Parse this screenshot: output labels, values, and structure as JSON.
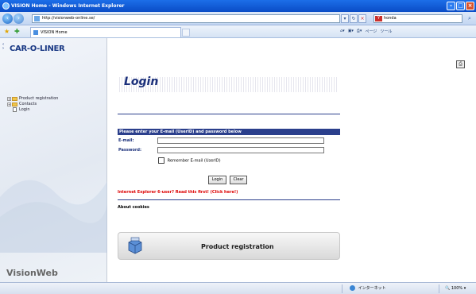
{
  "window": {
    "title": "VISION Home - Windows Internet Explorer"
  },
  "navbar": {
    "address": "http://visionweb-online.se/",
    "search_value": "honda"
  },
  "tabbar": {
    "tab_label": "VISION Home",
    "commands": [
      "ページ",
      "ツール"
    ]
  },
  "sidebar": {
    "logo": "CAR-O-LINER",
    "tree": [
      {
        "label": "Product registration",
        "type": "folder"
      },
      {
        "label": "Contacts",
        "type": "folder"
      },
      {
        "label": "Login",
        "type": "doc"
      }
    ],
    "footer": "VisionWeb"
  },
  "main": {
    "title": "Login",
    "form_header": "Please enter your E-mail (UserID) and password below",
    "email_label": "E-mail:",
    "email_value": "",
    "password_label": "Password:",
    "password_value": "",
    "remember_label": "Remember E-mail (UserID)",
    "login_button": "Login",
    "clear_button": "Clear",
    "ie6_warning": "Internet Explorer 6-user? Read this first! (Click here!)",
    "about_cookies": "About cookies",
    "product_registration": "Product registration"
  },
  "statusbar": {
    "zone": "インターネット",
    "zoom": "100%"
  },
  "colors": {
    "brand_blue": "#1a2f7a",
    "form_header_bg": "#2b3f8c",
    "warning_red": "#dd0000"
  }
}
